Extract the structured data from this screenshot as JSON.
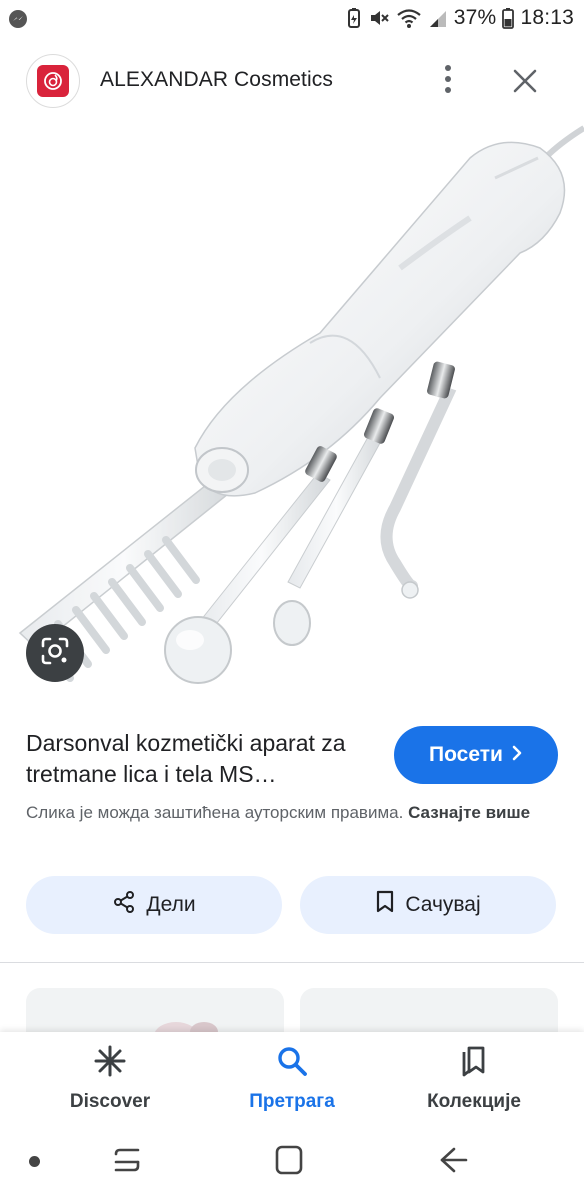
{
  "status_bar": {
    "battery": "37%",
    "time": "18:13",
    "icons": [
      "messenger-icon",
      "battery-saver-icon",
      "mute-icon",
      "wifi-icon",
      "signal-icon",
      "battery-icon"
    ]
  },
  "header": {
    "site_name": "ALEXANDAR Cosmetics",
    "logo_color": "#d9233b"
  },
  "result": {
    "title": "Darsonval kozmetički aparat za tretmane lica i tela MS…",
    "visit_label": "Посети",
    "copyright_text": "Слика је можда заштићена ауторским правима.",
    "copyright_link": "Сазнајте више"
  },
  "actions": {
    "share_label": "Дели",
    "save_label": "Сачувај"
  },
  "bottom_nav": {
    "items": [
      {
        "label": "Discover",
        "icon": "asterisk-icon",
        "active": false
      },
      {
        "label": "Претрага",
        "icon": "search-icon",
        "active": true
      },
      {
        "label": "Колекције",
        "icon": "collections-icon",
        "active": false
      }
    ]
  },
  "colors": {
    "accent": "#1a73e8",
    "chip_bg": "#e8f0fe"
  }
}
